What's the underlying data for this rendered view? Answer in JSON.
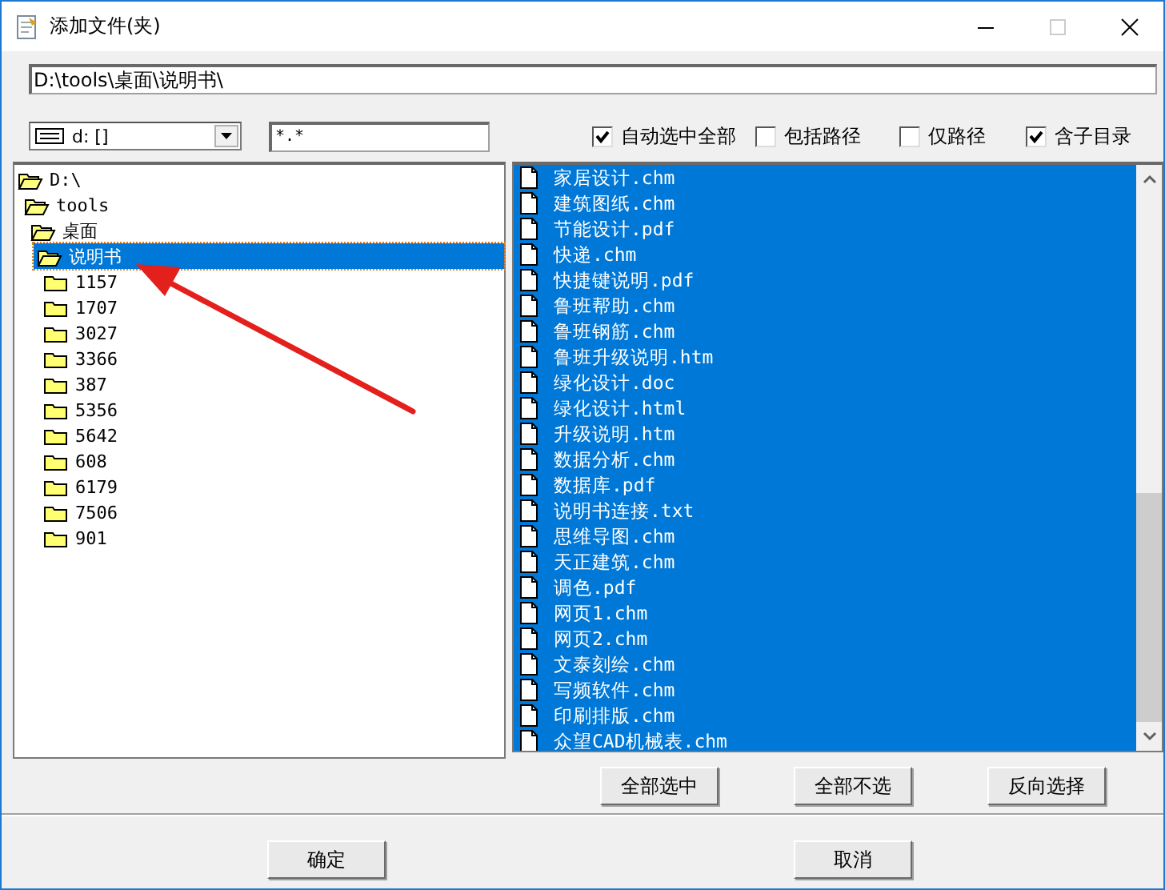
{
  "window": {
    "title": "添加文件(夹)"
  },
  "path_field": {
    "value": "D:\\tools\\桌面\\说明书\\"
  },
  "drive_combo": {
    "value": "d: []"
  },
  "filter_field": {
    "value": "*.*"
  },
  "options": [
    {
      "label": "自动选中全部",
      "checked": true
    },
    {
      "label": "包括路径",
      "checked": false
    },
    {
      "label": "仅路径",
      "checked": false
    },
    {
      "label": "含子目录",
      "checked": true
    }
  ],
  "folder_tree": [
    {
      "label": "D:\\",
      "expanded": true,
      "selected": false,
      "children": [
        {
          "label": "tools",
          "expanded": true,
          "selected": false,
          "children": [
            {
              "label": "桌面",
              "expanded": true,
              "selected": false,
              "children": [
                {
                  "label": "说明书",
                  "expanded": true,
                  "selected": true,
                  "children": [
                    {
                      "label": "1157",
                      "expanded": false,
                      "selected": false
                    },
                    {
                      "label": "1707",
                      "expanded": false,
                      "selected": false
                    },
                    {
                      "label": "3027",
                      "expanded": false,
                      "selected": false
                    },
                    {
                      "label": "3366",
                      "expanded": false,
                      "selected": false
                    },
                    {
                      "label": "387",
                      "expanded": false,
                      "selected": false
                    },
                    {
                      "label": "5356",
                      "expanded": false,
                      "selected": false
                    },
                    {
                      "label": "5642",
                      "expanded": false,
                      "selected": false
                    },
                    {
                      "label": "608",
                      "expanded": false,
                      "selected": false
                    },
                    {
                      "label": "6179",
                      "expanded": false,
                      "selected": false
                    },
                    {
                      "label": "7506",
                      "expanded": false,
                      "selected": false
                    },
                    {
                      "label": "901",
                      "expanded": false,
                      "selected": false
                    }
                  ]
                }
              ]
            }
          ]
        }
      ]
    }
  ],
  "files": [
    {
      "name": "家居设计.chm",
      "selected": true
    },
    {
      "name": "建筑图纸.chm",
      "selected": true
    },
    {
      "name": "节能设计.pdf",
      "selected": true
    },
    {
      "name": "快递.chm",
      "selected": true
    },
    {
      "name": "快捷键说明.pdf",
      "selected": true
    },
    {
      "name": "鲁班帮助.chm",
      "selected": true
    },
    {
      "name": "鲁班钢筋.chm",
      "selected": true
    },
    {
      "name": "鲁班升级说明.htm",
      "selected": true
    },
    {
      "name": "绿化设计.doc",
      "selected": true
    },
    {
      "name": "绿化设计.html",
      "selected": true
    },
    {
      "name": "升级说明.htm",
      "selected": true
    },
    {
      "name": "数据分析.chm",
      "selected": true
    },
    {
      "name": "数据库.pdf",
      "selected": true
    },
    {
      "name": "说明书连接.txt",
      "selected": true
    },
    {
      "name": "思维导图.chm",
      "selected": true
    },
    {
      "name": "天正建筑.chm",
      "selected": true
    },
    {
      "name": "调色.pdf",
      "selected": true
    },
    {
      "name": "网页1.chm",
      "selected": true
    },
    {
      "name": "网页2.chm",
      "selected": true
    },
    {
      "name": "文泰刻绘.chm",
      "selected": true
    },
    {
      "name": "写频软件.chm",
      "selected": true
    },
    {
      "name": "印刷排版.chm",
      "selected": true
    },
    {
      "name": "众望CAD机械表.chm",
      "selected": true
    }
  ],
  "list_buttons": [
    "全部选中",
    "全部不选",
    "反向选择"
  ],
  "dialog_buttons": [
    "确定",
    "取消"
  ]
}
